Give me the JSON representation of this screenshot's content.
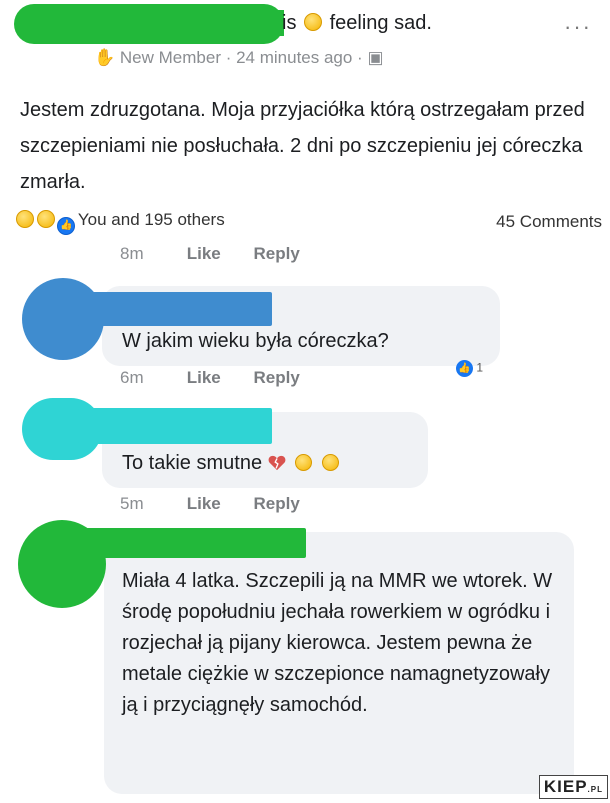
{
  "post": {
    "status_is": "is",
    "status_feeling": "feeling sad.",
    "more": "···",
    "meta": "New Member · 24 minutes ago ·",
    "body": "Jestem zdruzgotana. Moja przyjaciółka którą ostrzegałam przed szczepieniami nie posłuchała. 2 dni po szczepieniu jej córeczka zmarła.",
    "reactions_text": "You and 195 others",
    "comments_count": "45 Comments"
  },
  "actions": {
    "like": "Like",
    "reply": "Reply"
  },
  "comments": [
    {
      "time": "8m"
    },
    {
      "text": "W jakim wieku była córeczka?",
      "time": "6m",
      "reaction_count": "1",
      "avatar_color": "#3f8ccf"
    },
    {
      "text": "To takie smutne",
      "time": "5m",
      "avatar_color": "#2fd4d4"
    },
    {
      "text": "Miała 4 latka. Szczepili ją na MMR we wtorek. W środę popołudniu jechała rowerkiem w ogródku i rozjechał ją pijany kierowca. Jestem pewna że metale ciężkie w szczepionce namagnetyzowały ją i przyciągnęły samochód.",
      "avatar_color": "#22b83a"
    }
  ],
  "watermark": {
    "main": "KIEP",
    "suffix": ".PL"
  }
}
